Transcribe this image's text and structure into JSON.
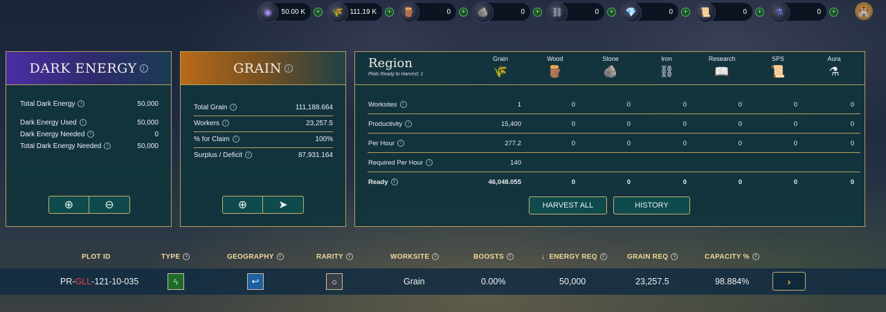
{
  "resources": [
    {
      "icon": "dark-energy-icon",
      "glyph": "◉",
      "color": "#a58cff",
      "value": "50.00 K",
      "width": 78
    },
    {
      "icon": "grain-icon",
      "glyph": "🌾",
      "color": "#e6b440",
      "value": "111.19 K",
      "width": 80
    },
    {
      "icon": "wood-icon",
      "glyph": "🪵",
      "color": "#c7834a",
      "value": "0",
      "width": 84
    },
    {
      "icon": "stone-icon",
      "glyph": "🪨",
      "color": "#9aa39a",
      "value": "0",
      "width": 84
    },
    {
      "icon": "iron-icon",
      "glyph": "⛓",
      "color": "#c0c8d8",
      "value": "0",
      "width": 84
    },
    {
      "icon": "research-crystal-icon",
      "glyph": "💎",
      "color": "#79d0ff",
      "value": "0",
      "width": 84
    },
    {
      "icon": "sps-scroll-icon",
      "glyph": "📜",
      "color": "#f0d17a",
      "value": "0",
      "width": 84
    },
    {
      "icon": "aura-icon",
      "glyph": "⚗",
      "color": "#6c7bff",
      "value": "0",
      "width": 84
    }
  ],
  "dark_energy": {
    "title": "DARK ENERGY",
    "rows": [
      {
        "label": "Total Dark Energy",
        "value": "50,000"
      },
      {
        "label": "Dark Energy Used",
        "value": "50,000"
      },
      {
        "label": "Dark Energy Needed",
        "value": "0"
      },
      {
        "label": "Total Dark Energy Needed",
        "value": "50,000"
      }
    ],
    "btn_add": "⊕",
    "btn_remove": "⊖"
  },
  "grain": {
    "title": "GRAIN",
    "rows": [
      {
        "label": "Total Grain",
        "value": "111,188.664"
      },
      {
        "label": "Workers",
        "value": "23,257.5"
      },
      {
        "label": "% for Claim",
        "value": "100%"
      },
      {
        "label": "Surplus / Deficit",
        "value": "87,931.164"
      }
    ],
    "btn_add": "⊕",
    "btn_send": "➤"
  },
  "region": {
    "title": "Region",
    "subtitle": "Plots Ready to Harvest: 1",
    "columns": [
      {
        "label": "Grain",
        "icon": "grain-icon",
        "glyph": "🌾"
      },
      {
        "label": "Wood",
        "icon": "wood-icon",
        "glyph": "🪵"
      },
      {
        "label": "Stone",
        "icon": "stone-icon",
        "glyph": "🪨"
      },
      {
        "label": "Iron",
        "icon": "iron-icon",
        "glyph": "⛓"
      },
      {
        "label": "Research",
        "icon": "research-icon",
        "glyph": "📖"
      },
      {
        "label": "SPS",
        "icon": "sps-icon",
        "glyph": "📜"
      },
      {
        "label": "Aura",
        "icon": "aura-icon",
        "glyph": "⚗"
      }
    ],
    "rows": [
      {
        "label": "Worksites",
        "values": [
          "1",
          "0",
          "0",
          "0",
          "0",
          "0",
          "0"
        ]
      },
      {
        "label": "Productivity",
        "values": [
          "15,400",
          "0",
          "0",
          "0",
          "0",
          "0",
          "0"
        ]
      },
      {
        "label": "Per Hour",
        "values": [
          "277.2",
          "0",
          "0",
          "0",
          "0",
          "0",
          "0"
        ]
      },
      {
        "label": "Required Per Hour",
        "values": [
          "140",
          "",
          "",
          "",
          "",
          "",
          ""
        ]
      },
      {
        "label": "Ready",
        "values": [
          "46,048.055",
          "0",
          "0",
          "0",
          "0",
          "0",
          "0"
        ]
      }
    ],
    "harvest_all": "HARVEST ALL",
    "history": "HISTORY"
  },
  "plots": {
    "headers": {
      "plot_id": "PLOT ID",
      "type": "TYPE",
      "geography": "GEOGRAPHY",
      "rarity": "RARITY",
      "worksite": "WORKSITE",
      "boosts": "BOOSTS",
      "sort_arrow": "↓",
      "energy_req": "ENERGY REQ",
      "grain_req": "GRAIN REQ",
      "capacity": "CAPACITY %"
    },
    "row": {
      "plot_id_prefix": "PR-",
      "plot_id_mid": "GLL",
      "plot_id_suffix": "-121-10-035",
      "type_glyph": "ϟ",
      "geography_glyph": "↩",
      "rarity_glyph": "○",
      "worksite": "Grain",
      "boosts": "0.00%",
      "energy_req": "50,000",
      "grain_req": "23,257.5",
      "capacity": "98.884%",
      "go_glyph": "›"
    }
  }
}
